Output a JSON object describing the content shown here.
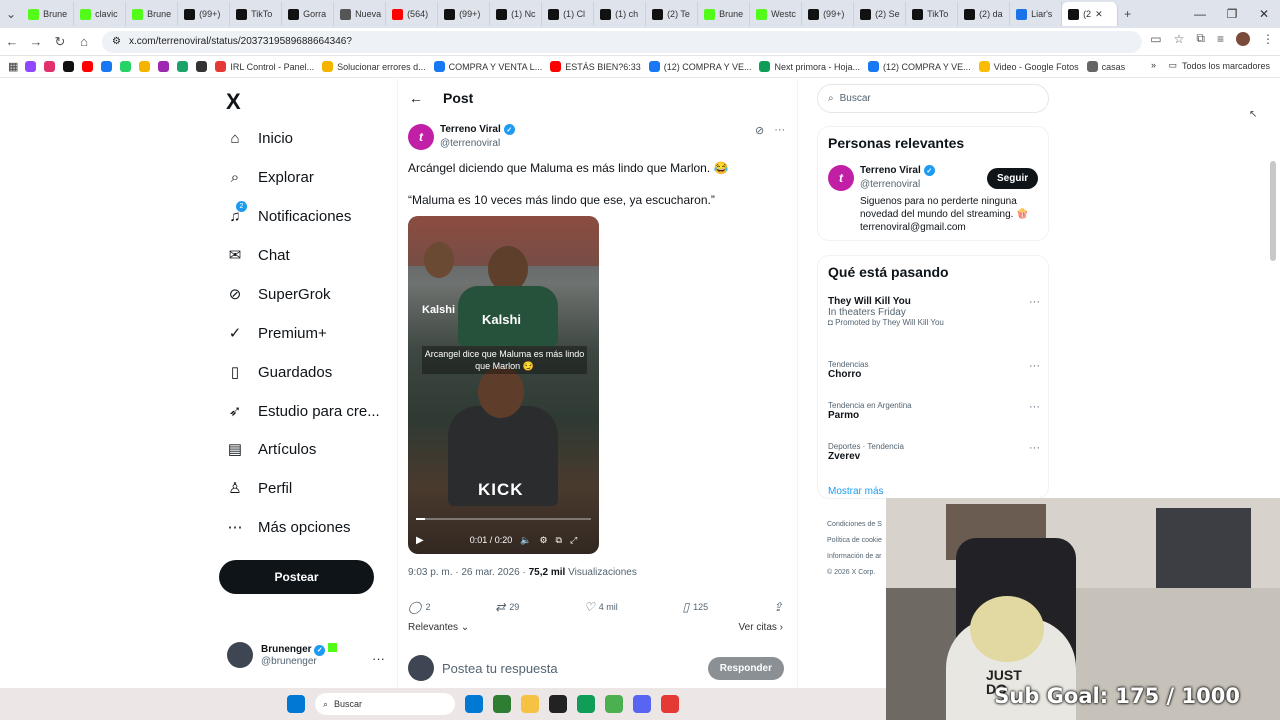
{
  "browser": {
    "tabs": [
      {
        "label": "Brune",
        "color": "#53fc18"
      },
      {
        "label": "clavic",
        "color": "#53fc18"
      },
      {
        "label": "Brune",
        "color": "#53fc18"
      },
      {
        "label": "(99+)",
        "color": "#111111"
      },
      {
        "label": "TikTo",
        "color": "#111111"
      },
      {
        "label": "Gorra",
        "color": "#111111"
      },
      {
        "label": "Nueva",
        "color": "#555555"
      },
      {
        "label": "(564)",
        "color": "#ff0000"
      },
      {
        "label": "(99+)",
        "color": "#111111"
      },
      {
        "label": "(1) Nc",
        "color": "#111111"
      },
      {
        "label": "(1) Cl",
        "color": "#111111"
      },
      {
        "label": "(1) ch",
        "color": "#111111"
      },
      {
        "label": "(2) Te",
        "color": "#111111"
      },
      {
        "label": "Brune",
        "color": "#53fc18"
      },
      {
        "label": "Westc",
        "color": "#53fc18"
      },
      {
        "label": "(99+)",
        "color": "#111111"
      },
      {
        "label": "(2) Se",
        "color": "#111111"
      },
      {
        "label": "TikTo",
        "color": "#111111"
      },
      {
        "label": "(2) da",
        "color": "#111111"
      },
      {
        "label": "Liar's",
        "color": "#1a73e8"
      }
    ],
    "active_tab": {
      "label": "(2",
      "close": "✕"
    },
    "new_tab": "+",
    "url": "x.com/terrenoviral/status/2037319589688664346?",
    "bookmarks": [
      {
        "label": "",
        "color": "#9146ff"
      },
      {
        "label": "",
        "color": "#e1306c"
      },
      {
        "label": "",
        "color": "#111111"
      },
      {
        "label": "",
        "color": "#ff0000"
      },
      {
        "label": "",
        "color": "#1877f2"
      },
      {
        "label": "",
        "color": "#25d366"
      },
      {
        "label": "",
        "color": "#f4b400"
      },
      {
        "label": "",
        "color": "#9c27b0"
      },
      {
        "label": "",
        "color": "#1ca36a"
      },
      {
        "label": "",
        "color": "#333333"
      },
      {
        "label": "IRL Control - Panel...",
        "color": "#e53935"
      },
      {
        "label": "Solucionar errores d...",
        "color": "#f4b400"
      },
      {
        "label": "COMPRA Y VENTA L...",
        "color": "#1877f2"
      },
      {
        "label": "ESTÁS BIEN?6:33",
        "color": "#ff0000"
      },
      {
        "label": "(12) COMPRA Y VE...",
        "color": "#1877f2"
      },
      {
        "label": "Next primora - Hoja...",
        "color": "#0f9d58"
      },
      {
        "label": "(12) COMPRA Y VE...",
        "color": "#1877f2"
      },
      {
        "label": "Video - Google Fotos",
        "color": "#fbbc04"
      },
      {
        "label": "casas",
        "color": "#666666"
      }
    ],
    "bookmarks_all": "Todos los marcadores",
    "bookmarks_more": "»"
  },
  "nav": {
    "logo": "X",
    "notifications_badge": "2",
    "items": [
      {
        "label": "Inicio",
        "icon": "home-icon"
      },
      {
        "label": "Explorar",
        "icon": "search-icon"
      },
      {
        "label": "Notificaciones",
        "icon": "bell-icon"
      },
      {
        "label": "Chat",
        "icon": "mail-icon"
      },
      {
        "label": "SuperGrok",
        "icon": "grok-icon"
      },
      {
        "label": "Premium+",
        "icon": "premium-icon"
      },
      {
        "label": "Guardados",
        "icon": "bookmark-icon"
      },
      {
        "label": "Estudio para cre...",
        "icon": "rocket-icon"
      },
      {
        "label": "Artículos",
        "icon": "article-icon"
      },
      {
        "label": "Perfil",
        "icon": "person-icon"
      },
      {
        "label": "Más opciones",
        "icon": "more-icon"
      }
    ],
    "post_button": "Postear",
    "account": {
      "name": "Brunenger",
      "handle": "@brunenger"
    }
  },
  "post": {
    "header": "Post",
    "author_name": "Terreno Viral",
    "author_handle": "@terrenoviral",
    "text1": "Arcángel diciendo que Maluma es más lindo que Marlon. 😂",
    "text2": "“Maluma es 10 veces más lindo que ese, ya escucharon.”",
    "video": {
      "caption": "Arcangel dice que Maluma es más lindo que Marlon 😏",
      "watermark": "KICK",
      "shirt_text": "Kalshi",
      "time": "0:01 / 0:20",
      "progress": 0.05
    },
    "meta_time": "9:03 p. m. · 26 mar. 2026 · ",
    "views_count": "75,2 mil",
    "views_label": " Visualizaciones",
    "actions": {
      "replies": "2",
      "reposts": "29",
      "likes": "4 mil",
      "bookmarks": "125"
    },
    "sort_label": "Relevantes",
    "quotes_link": "Ver citas ›",
    "reply_placeholder": "Postea tu respuesta",
    "reply_button": "Responder"
  },
  "sidebar": {
    "search_placeholder": "Buscar",
    "relevant_title": "Personas relevantes",
    "relevant": {
      "name": "Terreno Viral",
      "handle": "@terrenoviral",
      "follow": "Seguir",
      "bio": "Siguenos para no perderte ninguna novedad del mundo del streaming. 🍿 terrenoviral@gmail.com"
    },
    "trending_title": "Qué está pasando",
    "trends": [
      {
        "context": "",
        "title": "They Will Kill You",
        "sub": "In theaters Friday",
        "promo": "Promoted by They Will Kill You"
      },
      {
        "context": "Tendencias",
        "title": "Chorro",
        "sub": "",
        "promo": ""
      },
      {
        "context": "Tendencia en Argentina",
        "title": "Parmo",
        "sub": "",
        "promo": ""
      },
      {
        "context": "Deportes · Tendencia",
        "title": "Zverev",
        "sub": "",
        "promo": ""
      }
    ],
    "show_more": "Mostrar más",
    "footer": [
      "Condiciones de S",
      "Política de cookie",
      "Información de ar",
      "© 2026 X Corp."
    ]
  },
  "overlay": {
    "subgoal": "Sub Goal:  175 / 1000",
    "shirt": "JUST DO"
  },
  "taskbar": {
    "search": "Buscar",
    "apps": [
      "#0078d4",
      "#2e7d32",
      "#f6c244",
      "#222222",
      "#0f9d58",
      "#4caf50",
      "#5865f2",
      "#e53935"
    ]
  }
}
